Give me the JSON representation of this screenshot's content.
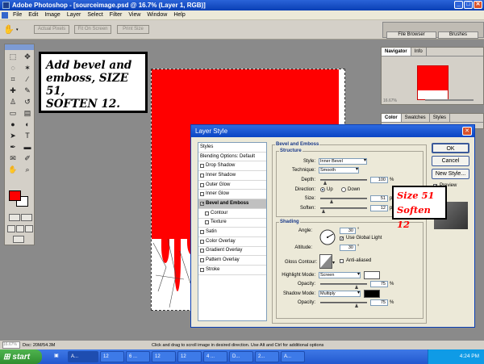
{
  "window": {
    "title": "Adobe Photoshop - [sourceimage.psd @ 16.7% (Layer 1, RGB)]"
  },
  "menu": [
    "File",
    "Edit",
    "Image",
    "Layer",
    "Select",
    "Filter",
    "View",
    "Window",
    "Help"
  ],
  "options_bar": {
    "actual_pixels": "Actual Pixels",
    "fit_on_screen": "Fit On Screen",
    "print_size": "Print Size",
    "file_browser_tab": "File Browser",
    "brushes_tab": "Brushes"
  },
  "annotation_main": {
    "line1": "Add bevel and",
    "line2": "emboss, SIZE 51,",
    "line3": "SOFTEN 12."
  },
  "navigator": {
    "tabs": [
      "Navigator",
      "Info"
    ],
    "zoom": "16.67%"
  },
  "color_panel": {
    "tabs": [
      "Color",
      "Swatches",
      "Styles"
    ]
  },
  "dialog": {
    "title": "Layer Style",
    "styles_list": [
      {
        "label": "Styles",
        "checkbox": false,
        "checked": false,
        "sub": false,
        "selected": false
      },
      {
        "label": "Blending Options: Default",
        "checkbox": false,
        "checked": false,
        "sub": false,
        "selected": false
      },
      {
        "label": "Drop Shadow",
        "checkbox": true,
        "checked": false,
        "sub": false,
        "selected": false
      },
      {
        "label": "Inner Shadow",
        "checkbox": true,
        "checked": false,
        "sub": false,
        "selected": false
      },
      {
        "label": "Outer Glow",
        "checkbox": true,
        "checked": false,
        "sub": false,
        "selected": false
      },
      {
        "label": "Inner Glow",
        "checkbox": true,
        "checked": false,
        "sub": false,
        "selected": false
      },
      {
        "label": "Bevel and Emboss",
        "checkbox": true,
        "checked": true,
        "sub": false,
        "selected": true
      },
      {
        "label": "Contour",
        "checkbox": true,
        "checked": false,
        "sub": true,
        "selected": false
      },
      {
        "label": "Texture",
        "checkbox": true,
        "checked": false,
        "sub": true,
        "selected": false
      },
      {
        "label": "Satin",
        "checkbox": true,
        "checked": false,
        "sub": false,
        "selected": false
      },
      {
        "label": "Color Overlay",
        "checkbox": true,
        "checked": false,
        "sub": false,
        "selected": false
      },
      {
        "label": "Gradient Overlay",
        "checkbox": true,
        "checked": false,
        "sub": false,
        "selected": false
      },
      {
        "label": "Pattern Overlay",
        "checkbox": true,
        "checked": false,
        "sub": false,
        "selected": false
      },
      {
        "label": "Stroke",
        "checkbox": true,
        "checked": false,
        "sub": false,
        "selected": false
      }
    ],
    "bevel": {
      "group_title": "Bevel and Emboss",
      "structure_title": "Structure",
      "style_label": "Style:",
      "style_value": "Inner Bevel",
      "technique_label": "Technique:",
      "technique_value": "Smooth",
      "depth_label": "Depth:",
      "depth_value": "100",
      "depth_unit": "%",
      "direction_label": "Direction:",
      "direction_up": "Up",
      "direction_down": "Down",
      "size_label": "Size:",
      "size_value": "51",
      "size_unit": "px",
      "soften_label": "Soften:",
      "soften_value": "12",
      "soften_unit": "px",
      "shading_title": "Shading",
      "angle_label": "Angle:",
      "angle_value": "30",
      "angle_unit": "°",
      "global_light_label": "Use Global Light",
      "altitude_label": "Altitude:",
      "altitude_value": "30",
      "altitude_unit": "°",
      "gloss_label": "Gloss Contour:",
      "anti_aliased_label": "Anti-aliased",
      "highlight_label": "Highlight Mode:",
      "highlight_value": "Screen",
      "opacity1_label": "Opacity:",
      "opacity1_value": "75",
      "opacity1_unit": "%",
      "shadow_label": "Shadow Mode:",
      "shadow_value": "Multiply",
      "opacity2_label": "Opacity:",
      "opacity2_value": "75",
      "opacity2_unit": "%"
    },
    "buttons": {
      "ok": "OK",
      "cancel": "Cancel",
      "new_style": "New Style...",
      "preview": "Preview"
    }
  },
  "annotation_side": {
    "line1": "Size 51",
    "line2": "Soften 12"
  },
  "status": {
    "zoom": "16.67%",
    "doc": "Doc: 20M/54.3M",
    "hint": "Click and drag to scroll image in desired direction.  Use Alt and Ctrl for additional options"
  },
  "taskbar": {
    "start": "start",
    "tasks": [
      "A...",
      "12",
      "6 ...",
      "12",
      "12",
      "4 ...",
      "D...",
      "2...",
      "A..."
    ],
    "clock": "4:24 PM"
  },
  "colors": {
    "foreground": "#ff0000",
    "background": "#ffffff",
    "accent": "#0a3fb5"
  }
}
